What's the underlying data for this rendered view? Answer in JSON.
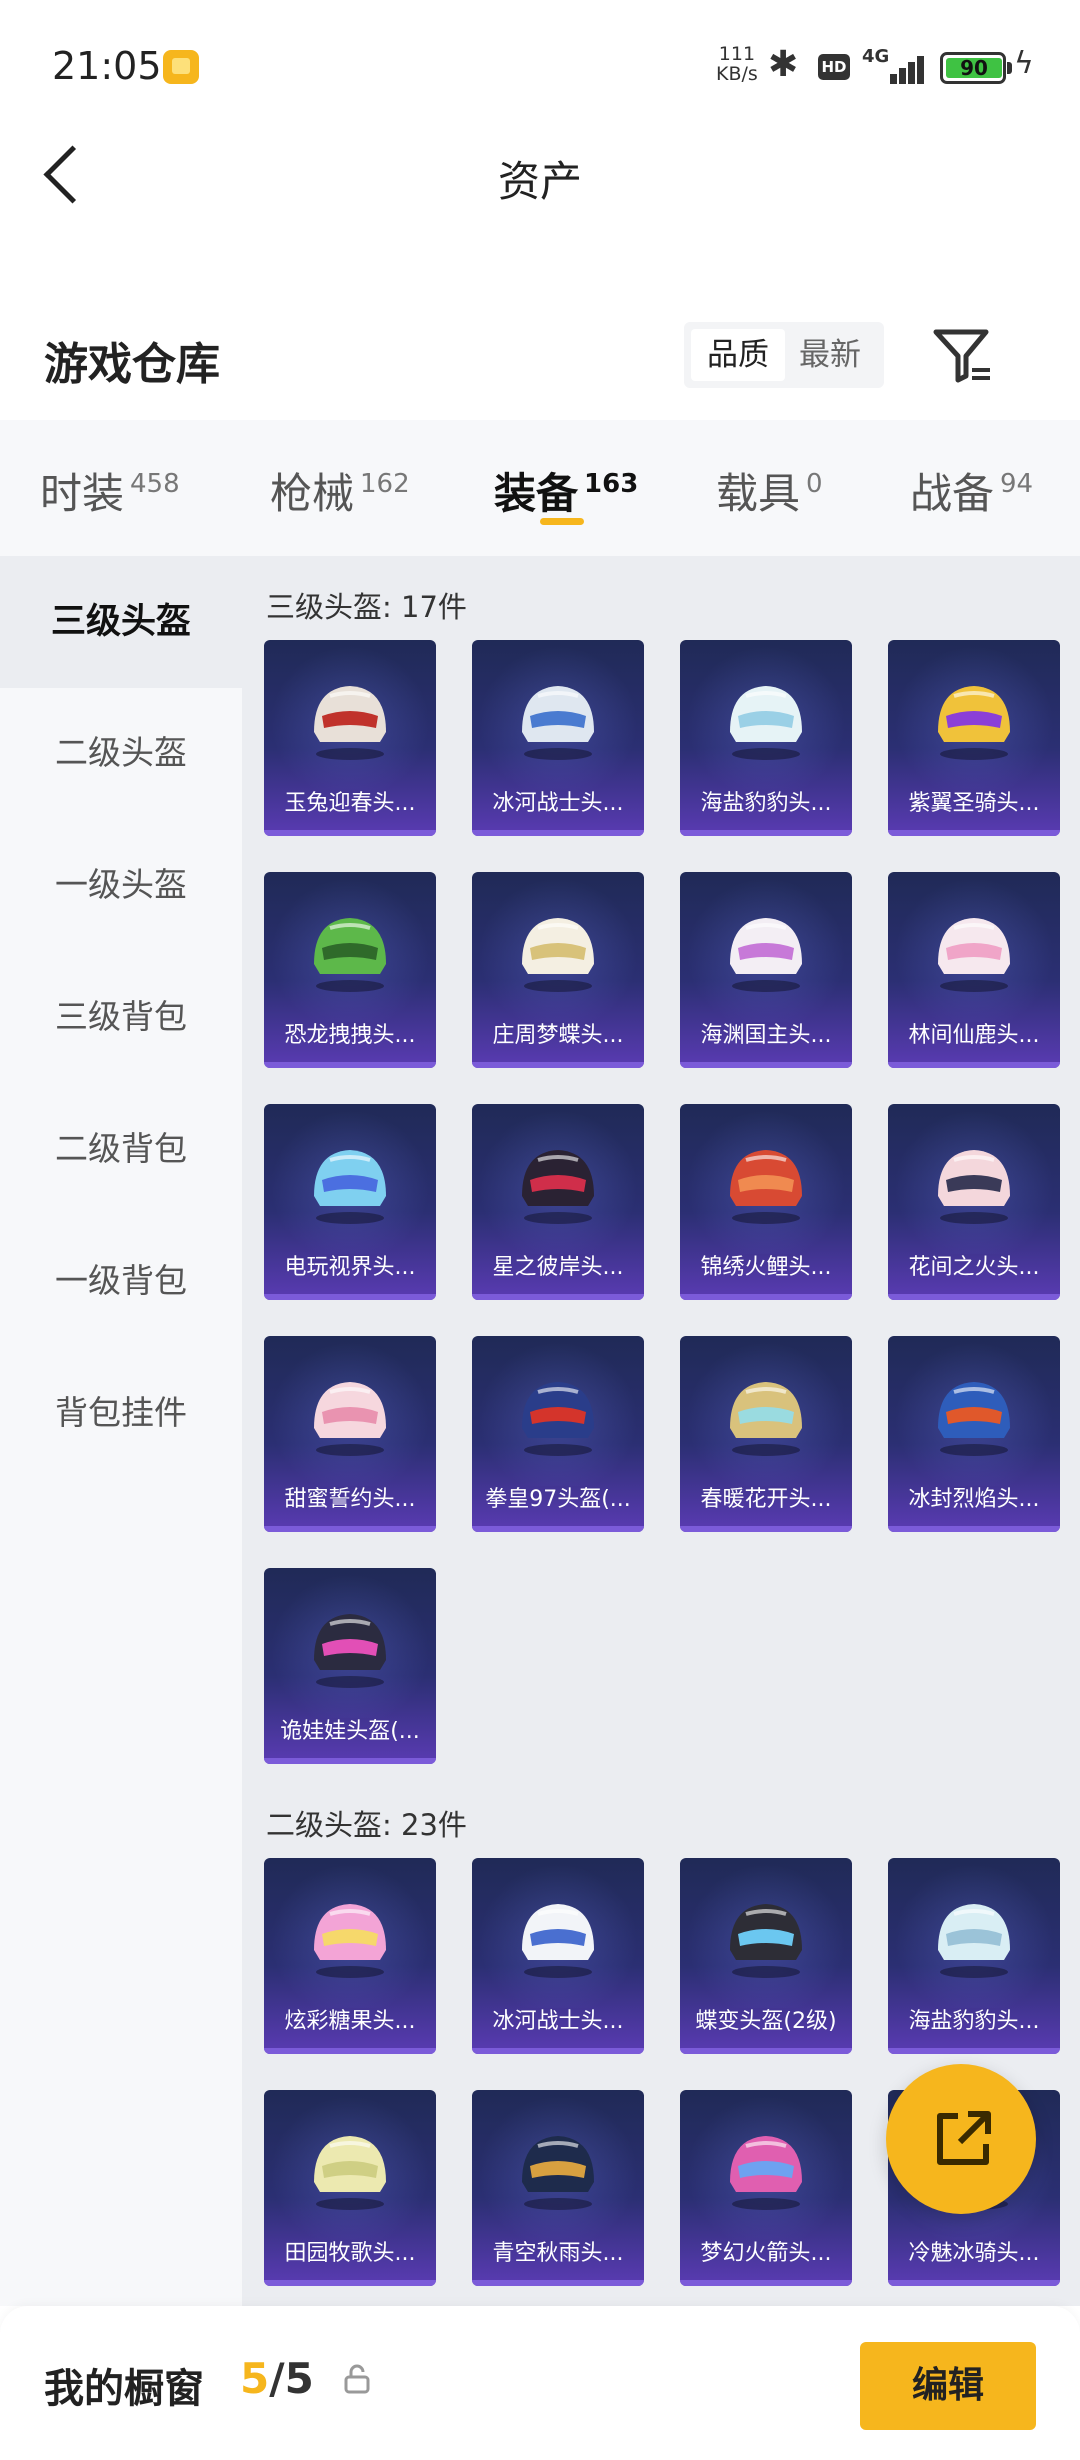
{
  "status_bar": {
    "time": "21:05",
    "speed_value": "111",
    "speed_unit": "KB/s",
    "hd": "HD",
    "network": "4G",
    "battery": "90"
  },
  "header": {
    "title": "资产"
  },
  "section": {
    "title": "游戏仓库",
    "sort_options": [
      "品质",
      "最新"
    ],
    "active_sort": 0
  },
  "tabs": [
    {
      "label": "时装",
      "count": "458"
    },
    {
      "label": "枪械",
      "count": "162"
    },
    {
      "label": "装备",
      "count": "163",
      "active": true
    },
    {
      "label": "载具",
      "count": "0"
    },
    {
      "label": "战备",
      "count": "94"
    }
  ],
  "sidebar": {
    "items": [
      "三级头盔",
      "二级头盔",
      "一级头盔",
      "三级背包",
      "二级背包",
      "一级背包",
      "背包挂件"
    ],
    "active": 0
  },
  "groups": [
    {
      "title": "三级头盔: 17件",
      "items": [
        "玉兔迎春头...",
        "冰河战士头...",
        "海盐豹豹头...",
        "紫翼圣骑头...",
        "恐龙拽拽头...",
        "庄周梦蝶头...",
        "海渊国主头...",
        "林间仙鹿头...",
        "电玩视界头...",
        "星之彼岸头...",
        "锦绣火鲤头...",
        "花间之火头...",
        "甜蜜誓约头...",
        "拳皇97头盔(...",
        "春暖花开头...",
        "冰封烈焰头...",
        "诡娃娃头盔(..."
      ]
    },
    {
      "title": "二级头盔: 23件",
      "items": [
        "炫彩糖果头...",
        "冰河战士头...",
        "蝶变头盔(2级)",
        "海盐豹豹头...",
        "田园牧歌头...",
        "青空秋雨头...",
        "梦幻火箭头...",
        "冷魅冰骑头..."
      ]
    }
  ],
  "bottom_bar": {
    "label": "我的橱窗",
    "current": "5",
    "total": "/5",
    "edit_label": "编辑"
  },
  "colors": {
    "accent": "#f6b61d",
    "card_top": "#202a57",
    "card_bottom": "#5a3bb3"
  }
}
